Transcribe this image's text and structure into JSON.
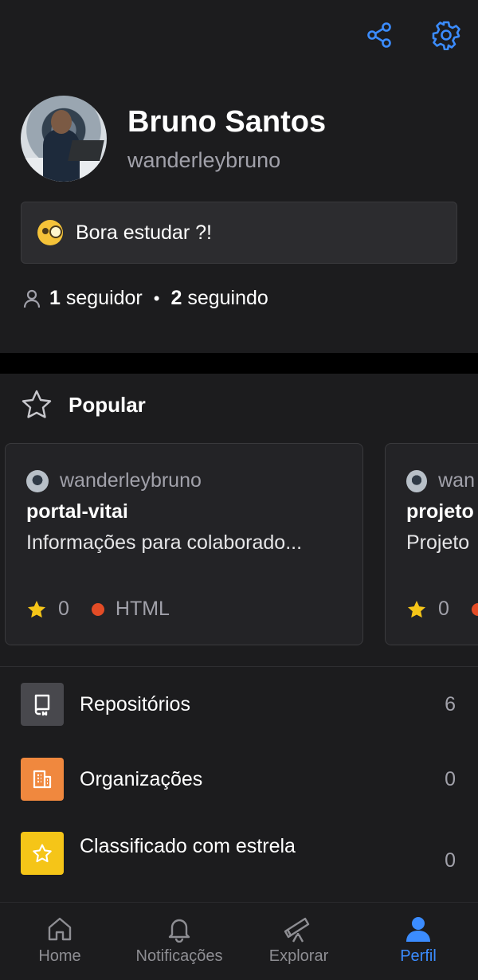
{
  "header": {
    "share_icon": "share-icon",
    "settings_icon": "gear-icon",
    "accent": "#3b8cff"
  },
  "profile": {
    "name": "Bruno Santos",
    "username": "wanderleybruno"
  },
  "status": {
    "emoji": "face-with-monocle",
    "text": "Bora estudar ?!"
  },
  "follow": {
    "followers_count": "1",
    "followers_label": "seguidor",
    "separator": "•",
    "following_count": "2",
    "following_label": "seguindo"
  },
  "popular": {
    "title": "Popular",
    "cards": [
      {
        "owner": "wanderleybruno",
        "repo": "portal-vitai",
        "description": "Informações para colaborado...",
        "stars": "0",
        "language": "HTML",
        "language_color": "#e34c26"
      },
      {
        "owner": "wan",
        "repo": "projeto",
        "description": "Projeto",
        "stars": "0",
        "language": "",
        "language_color": "#e34c26"
      }
    ]
  },
  "menu": [
    {
      "label": "Repositórios",
      "count": "6",
      "color": "#48484d",
      "icon": "repo-icon"
    },
    {
      "label": "Organizações",
      "count": "0",
      "color": "#f0883e",
      "icon": "building-icon"
    },
    {
      "label": "Classificado com estrela",
      "count": "0",
      "color": "#f5c518",
      "icon": "star-icon"
    }
  ],
  "tabs": [
    {
      "label": "Home",
      "icon": "home-icon"
    },
    {
      "label": "Notificações",
      "icon": "bell-icon"
    },
    {
      "label": "Explorar",
      "icon": "telescope-icon"
    },
    {
      "label": "Perfil",
      "icon": "person-icon",
      "active": true
    }
  ]
}
